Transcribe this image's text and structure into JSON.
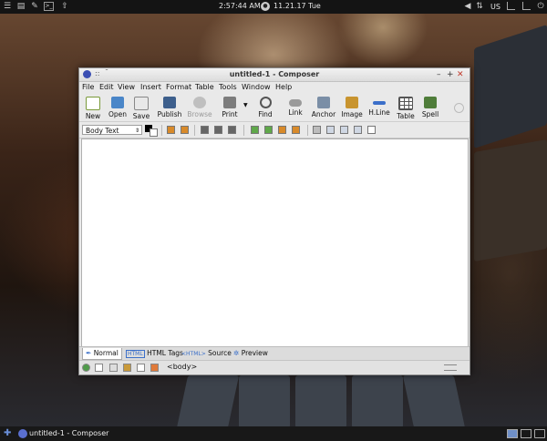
{
  "top_panel": {
    "time": "2:57:44 AM",
    "date": "11.21.17 Tue",
    "keyboard_layout": "US"
  },
  "window": {
    "title": "untitled-1 - Composer",
    "controls": {
      "minimize": "–",
      "maximize": "+",
      "close": "✕"
    }
  },
  "menu": [
    "File",
    "Edit",
    "View",
    "Insert",
    "Format",
    "Table",
    "Tools",
    "Window",
    "Help"
  ],
  "toolbar": [
    "New",
    "Open",
    "Save",
    "Publish",
    "Browse",
    "Print",
    "Find",
    "Link",
    "Anchor",
    "Image",
    "H.Line",
    "Table",
    "Spell"
  ],
  "format_bar": {
    "paragraph_style": "Body Text"
  },
  "tabs": [
    "Normal",
    "HTML Tags",
    "Source",
    "Preview"
  ],
  "tab_icons": {
    "html_tags": "HTML",
    "source": "<HTML>"
  },
  "status": {
    "tag_list": "<body>"
  },
  "taskbar": {
    "task_label": "untitled-1 - Composer"
  },
  "colors": {
    "accent": "#3b6fc9",
    "close": "#c0392b"
  }
}
